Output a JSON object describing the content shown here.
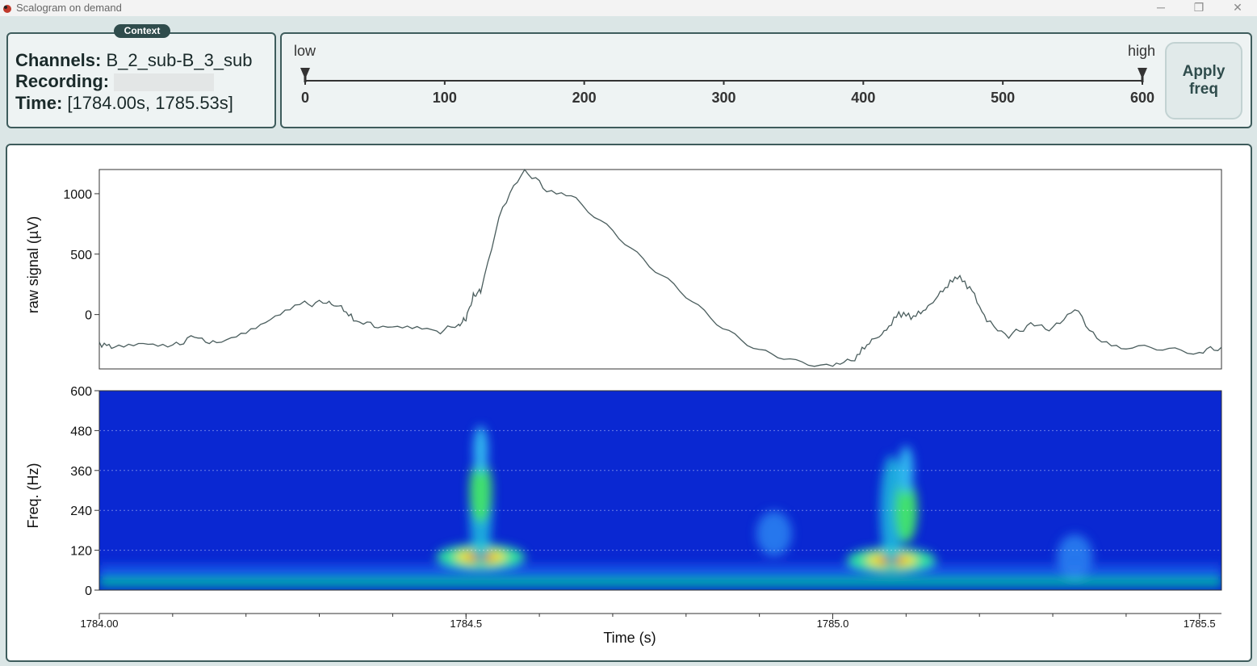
{
  "window": {
    "title": "Scalogram on demand",
    "controls": {
      "minimize": "─",
      "restore": "❐",
      "close": "✕"
    }
  },
  "context": {
    "badge": "Context",
    "channels_label": "Channels:",
    "channels_value": "B_2_sub-B_3_sub",
    "recording_label": "Recording:",
    "time_label": "Time:",
    "time_value": "[1784.00s, 1785.53s]"
  },
  "freq_slider": {
    "low_label": "low",
    "high_label": "high",
    "min": 0,
    "max": 600,
    "low_value": 0,
    "high_value": 600,
    "ticks": [
      "0",
      "100",
      "200",
      "300",
      "400",
      "500",
      "600"
    ],
    "apply_label_1": "Apply",
    "apply_label_2": "freq"
  },
  "colors": {
    "accent": "#2f4c4c",
    "panel_bg": "#eef3f3",
    "signal": "#4a5d5d",
    "scalogram_bg": "#0a28d2"
  },
  "chart_data": [
    {
      "type": "line",
      "ylabel": "raw signal (µV)",
      "xlabel": "",
      "xlim": [
        1784.0,
        1785.53
      ],
      "ylim": [
        -450,
        1200
      ],
      "yticks": [
        "1000",
        "500",
        "0"
      ],
      "x": [
        1784.0,
        1784.02,
        1784.06,
        1784.1,
        1784.13,
        1784.16,
        1784.2,
        1784.24,
        1784.28,
        1784.31,
        1784.33,
        1784.35,
        1784.38,
        1784.42,
        1784.46,
        1784.49,
        1784.5,
        1784.51,
        1784.52,
        1784.55,
        1784.58,
        1784.61,
        1784.65,
        1784.7,
        1784.75,
        1784.8,
        1784.85,
        1784.9,
        1784.95,
        1785.0,
        1785.03,
        1785.05,
        1785.07,
        1785.09,
        1785.11,
        1785.13,
        1785.15,
        1785.17,
        1785.19,
        1785.21,
        1785.24,
        1785.27,
        1785.3,
        1785.33,
        1785.36,
        1785.4,
        1785.45,
        1785.5,
        1785.53
      ],
      "y": [
        -240,
        -270,
        -220,
        -260,
        -180,
        -250,
        -130,
        -10,
        90,
        100,
        60,
        -60,
        -90,
        -120,
        -140,
        -90,
        -30,
        150,
        200,
        900,
        1200,
        1030,
        950,
        700,
        400,
        150,
        -100,
        -300,
        -400,
        -430,
        -360,
        -230,
        -150,
        10,
        -20,
        60,
        200,
        320,
        200,
        -60,
        -180,
        -80,
        -120,
        50,
        -200,
        -270,
        -290,
        -310,
        -270
      ]
    },
    {
      "type": "heatmap",
      "ylabel": "Freq. (Hz)",
      "xlabel": "Time (s)",
      "xlim": [
        1784.0,
        1785.53
      ],
      "ylim": [
        0,
        600
      ],
      "yticks": [
        "600",
        "480",
        "360",
        "240",
        "120",
        "0"
      ],
      "xticks": [
        "1784.00",
        "1784.5",
        "1785.0",
        "1785.5"
      ],
      "xtick_values": [
        1784.0,
        1784.5,
        1785.0,
        1785.5
      ],
      "hotspots": [
        {
          "t": 1784.52,
          "f": 100,
          "intensity": "high"
        },
        {
          "t": 1784.52,
          "f": 300,
          "intensity": "medium"
        },
        {
          "t": 1785.08,
          "f": 90,
          "intensity": "high"
        },
        {
          "t": 1785.1,
          "f": 240,
          "intensity": "medium"
        },
        {
          "t": 1784.92,
          "f": 170,
          "intensity": "low"
        },
        {
          "t": 1785.33,
          "f": 100,
          "intensity": "low"
        }
      ]
    }
  ]
}
